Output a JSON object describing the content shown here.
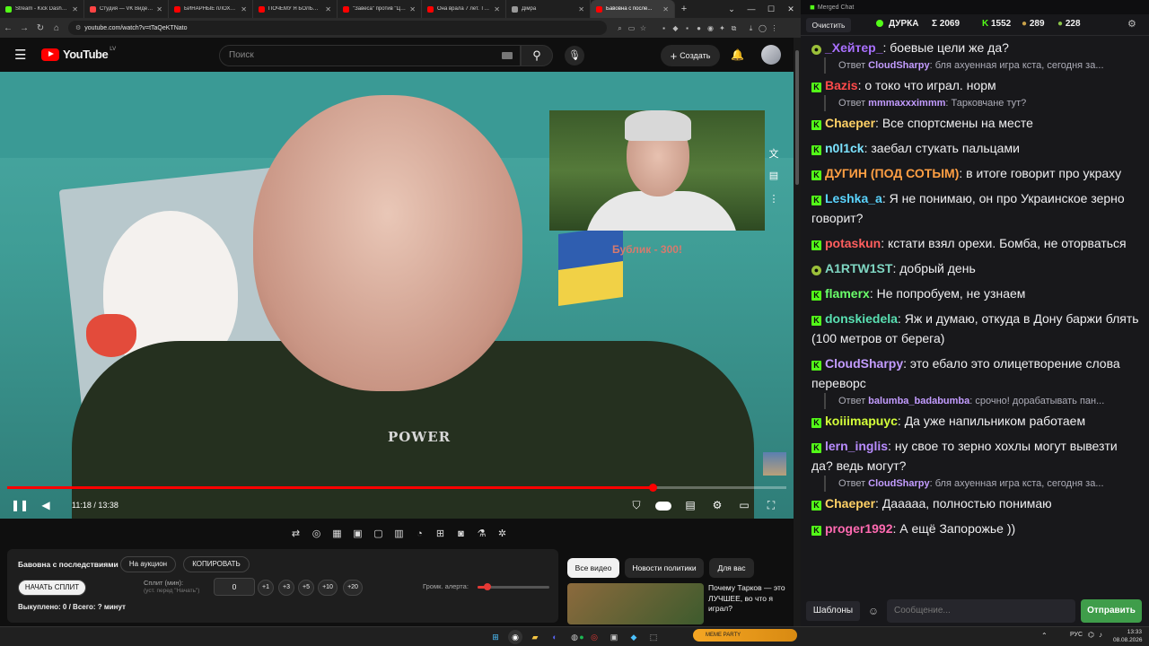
{
  "browser": {
    "tabs": [
      {
        "title": "Stream - Kick Dashboa...",
        "color": "#53fc18",
        "active": false
      },
      {
        "title": "Студия — VK Видео |",
        "color": "#ff4444",
        "active": false
      },
      {
        "title": "БИНАРНЫЕ пЛОХОП...",
        "color": "#ff0000",
        "active": false
      },
      {
        "title": "ПОЧЕМУ Я БОЛЬШЕ...",
        "color": "#ff0000",
        "active": false
      },
      {
        "title": "\"Завеса\" против \"Ци...",
        "color": "#ff0000",
        "active": false
      },
      {
        "title": "Она врала 7 лет. Тёл...",
        "color": "#ff0000",
        "active": false
      },
      {
        "title": "Дiмра",
        "color": "#999999",
        "active": false
      },
      {
        "title": "Бавовна с после...",
        "color": "#ff0000",
        "active": true
      }
    ],
    "url": "youtube.com/watch?v=tTaQeKTNato"
  },
  "youtube": {
    "logo_text": "YouTube",
    "region": "LV",
    "search_placeholder": "Поиск",
    "create_label": "Создать"
  },
  "video": {
    "inset_caption": "Бублик - 300!",
    "shirt_text": "POWER",
    "time_display": "11:18 / 13:38",
    "progress_fraction": 0.828
  },
  "panel": {
    "title": "Бавовна с последствиями",
    "auction_button": "На аукцион",
    "copy_button": "КОПИРОВАТЬ",
    "start_split_button": "НАЧАТЬ СПЛИТ",
    "split_label": "Сплит (мин):",
    "split_hint": "(уст. перед \"Начать\")",
    "split_value": "0",
    "step_buttons": [
      "+1",
      "+3",
      "+5",
      "+10",
      "+20"
    ],
    "alert_volume_label": "Громк. алерта:",
    "alert_volume_fraction": 0.14,
    "bought_text": "Выкуплено: 0 / Всего: ? минут"
  },
  "recommendations": {
    "chips": [
      "Все видео",
      "Новости политики",
      "Для вас"
    ],
    "first_title": "Почему Тарков — это ЛУЧШЕЕ, во что я играл?"
  },
  "chat": {
    "window_title": "Merged Chat",
    "clear_button": "Очистить",
    "stream_name": "ДУРКА",
    "stats": {
      "total": "Σ 2069",
      "kick": "1552",
      "other": "289",
      "third": "228"
    },
    "messages": [
      {
        "user": "_Хейтер_",
        "color": "#a970ff",
        "text": "боевые цели же да?",
        "badge": "pepe"
      },
      {
        "reply_to": "CloudSharpy",
        "reply_text": "бля ахуенная игра кста, сегодня за..."
      },
      {
        "user": "Bazis",
        "color": "#ff4a4a",
        "text": "о токо что играл. норм",
        "badge": "kick"
      },
      {
        "reply_to": "mmmaxxximmm",
        "reply_text": "Тарковчане тут?"
      },
      {
        "user": "Chaeper",
        "color": "#ffd166",
        "text": "Все спортсмены на месте",
        "badge": "kick"
      },
      {
        "user": "n0l1ck",
        "color": "#7ce3ff",
        "text": "заебал стукать пальцами",
        "badge": "kick"
      },
      {
        "user": "ДУГИН (ПОД СОТЫМ)",
        "color": "#ff9f43",
        "text": "в итоге говорит про украху",
        "badge": "kick"
      },
      {
        "user": "Leshka_a",
        "color": "#5ad4ff",
        "text": "Я не понимаю, он про Украинское зерно говорит?",
        "badge": "kick"
      },
      {
        "user": "potaskun",
        "color": "#ff5e5e",
        "text": "кстати взял орехи. Бомба, не оторваться",
        "badge": "kick"
      },
      {
        "user": "A1RTW1ST",
        "color": "#7fd6c2",
        "text": "добрый день",
        "badge": "pepe"
      },
      {
        "user": "flamerx",
        "color": "#6bff6b",
        "text": "Не попробуем, не узнаем",
        "badge": "kick"
      },
      {
        "user": "donskiedela",
        "color": "#59e0b2",
        "text": "Яж и думаю, откуда в Дону баржи блять (100 метров от берега)",
        "badge": "kick"
      },
      {
        "user": "CloudSharpy",
        "color": "#c39cff",
        "text": "это ебало это олицетворение слова переворс",
        "badge": "kick"
      },
      {
        "reply_to": "balumba_badabumba",
        "reply_text": "срочно! дорабатывать пан..."
      },
      {
        "user": "koiiimapuyc",
        "color": "#d4ff3a",
        "text": "Да уже напильником работаем",
        "badge": "kick"
      },
      {
        "user": "lern_inglis",
        "color": "#b88cff",
        "text": "ну свое то зерно хохлы могут вывезти да? ведь могут?",
        "badge": "kick"
      },
      {
        "reply_to": "CloudSharpy",
        "reply_text": "бля ахуенная игра кста, сегодня за..."
      },
      {
        "user": "Chaeper",
        "color": "#ffd166",
        "text": "Дааааа, полностью понимаю",
        "badge": "kick"
      },
      {
        "user": "proger1992",
        "color": "#ff6ab1",
        "text": "А ещё Запорожье ))",
        "badge": "kick"
      }
    ],
    "templates_button": "Шаблоны",
    "input_placeholder": "Сообщение...",
    "send_button": "Отправить",
    "accent": "#53fc18"
  },
  "taskbar": {
    "lang": "РУС",
    "time": "13:33",
    "date": "08.08.2026"
  }
}
